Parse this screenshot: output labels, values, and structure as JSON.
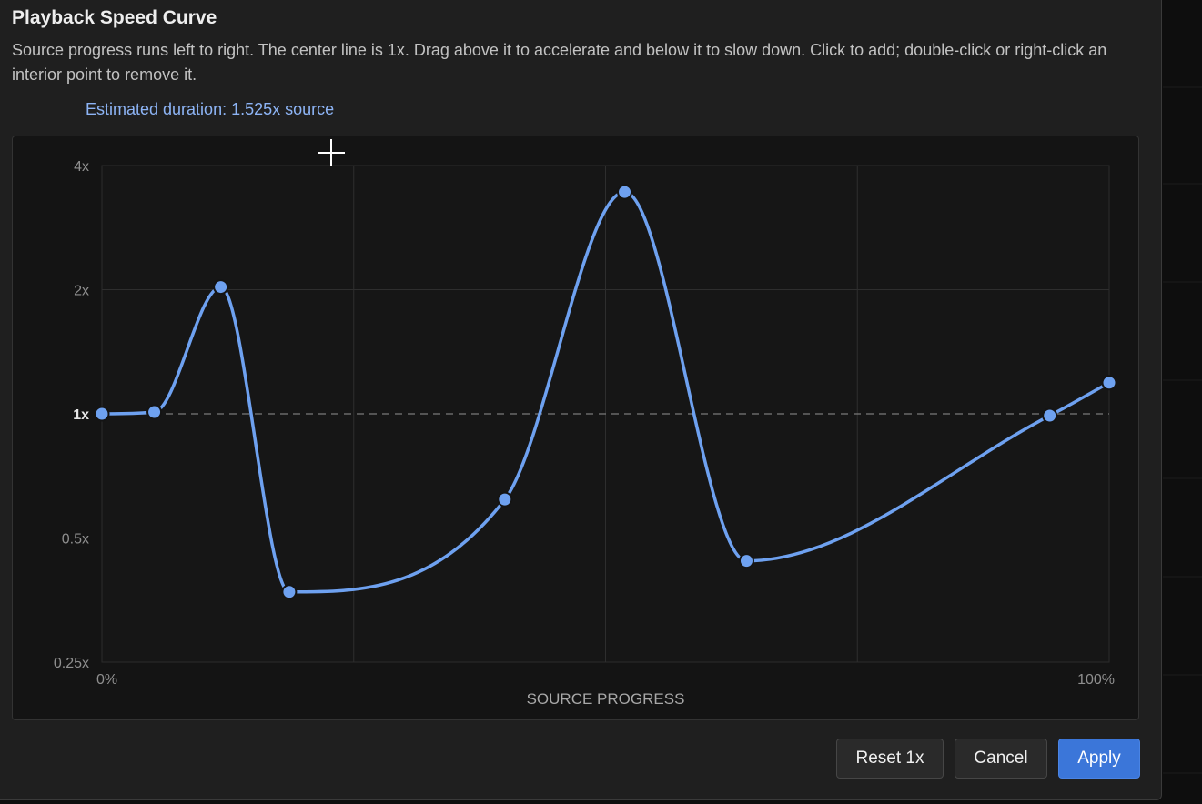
{
  "dialog": {
    "title": "Playback Speed Curve",
    "description": "Source progress runs left to right. The center line is 1x. Drag above it to accelerate and below it to slow down. Click to add; double-click or right-click an interior point to remove it.",
    "estimate": "Estimated duration: 1.525x source"
  },
  "buttons": {
    "reset": "Reset 1x",
    "cancel": "Cancel",
    "apply": "Apply"
  },
  "colors": {
    "curve": "#6ea1f0",
    "accent": "#3b76d9",
    "estimate_text": "#8db4f5"
  },
  "chart_data": {
    "type": "line",
    "xlabel": "SOURCE PROGRESS",
    "ylabel": "",
    "x_ticks": [
      {
        "value": 0,
        "label": "0%"
      },
      {
        "value": 100,
        "label": "100%"
      }
    ],
    "y_scale": "log2",
    "y_ticks": [
      {
        "value": 4,
        "label": "4x"
      },
      {
        "value": 2,
        "label": "2x"
      },
      {
        "value": 1,
        "label": "1x"
      },
      {
        "value": 0.5,
        "label": "0.5x"
      },
      {
        "value": 0.25,
        "label": "0.25x"
      }
    ],
    "xlim": [
      0,
      100
    ],
    "ylim": [
      0.25,
      4
    ],
    "grid": true,
    "reference_line": {
      "value": 1,
      "style": "dashed"
    },
    "series": [
      {
        "points": [
          {
            "x": 0.0,
            "y": 1.0
          },
          {
            "x": 5.2,
            "y": 1.01
          },
          {
            "x": 11.8,
            "y": 2.03
          },
          {
            "x": 18.6,
            "y": 0.37
          },
          {
            "x": 40.0,
            "y": 0.62
          },
          {
            "x": 51.9,
            "y": 3.45
          },
          {
            "x": 64.0,
            "y": 0.44
          },
          {
            "x": 94.1,
            "y": 0.99
          },
          {
            "x": 100.0,
            "y": 1.19
          }
        ]
      }
    ]
  }
}
